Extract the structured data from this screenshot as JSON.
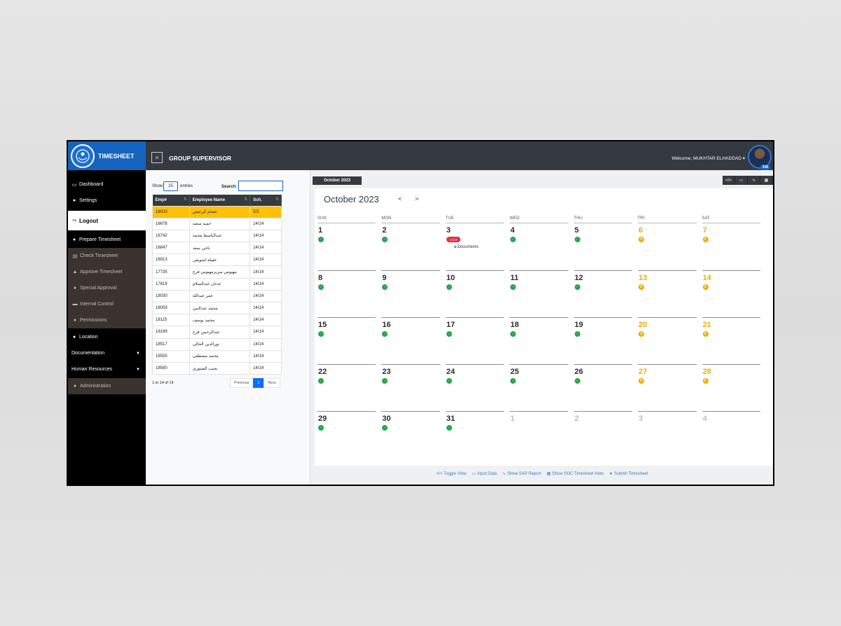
{
  "brand": {
    "title": "TIMESHEET"
  },
  "header": {
    "role_title": "GROUP SUPERVISOR",
    "welcome": "Welcome, MUKHTAR ELHADDAD",
    "avatar_badge": "348"
  },
  "sidebar": {
    "items": [
      {
        "label": "Dashboard",
        "icon": "monitor-icon"
      },
      {
        "label": "Settings",
        "icon": "user-cog-icon"
      },
      {
        "label": "Logout",
        "icon": "logout-icon"
      },
      {
        "label": "Prepare Timesheet",
        "icon": "user-cog-icon"
      },
      {
        "label": "Check Timesheet",
        "icon": "clipboard-icon"
      },
      {
        "label": "Approve Timesheet",
        "icon": "thumbs-up-icon"
      },
      {
        "label": "Special Approval",
        "icon": "user-icon"
      },
      {
        "label": "Internal Control",
        "icon": "id-card-icon"
      },
      {
        "label": "Permissions",
        "icon": "users-icon"
      },
      {
        "label": "Location",
        "icon": "users-icon"
      },
      {
        "label": "Documentation",
        "icon": "caret-down-icon"
      },
      {
        "label": "Human Resources",
        "icon": "caret-down-icon"
      },
      {
        "label": "Administration",
        "icon": "users-icon"
      }
    ]
  },
  "employees": {
    "show_label": "Show",
    "entries_value": "25",
    "entries_label": "entries",
    "search_label": "Search:",
    "columns": [
      "Emp#",
      "Employee Name",
      "Sch."
    ],
    "rows": [
      {
        "emp": "16023",
        "name": "عصام الرعيض",
        "sch": "5/2"
      },
      {
        "emp": "16678",
        "name": "حميد سعيد",
        "sch": "14/14"
      },
      {
        "emp": "16742",
        "name": "عبدالباسط محمد",
        "sch": "14/14"
      },
      {
        "emp": "16847",
        "name": "ناجي سعد",
        "sch": "14/14"
      },
      {
        "emp": "16913",
        "name": "عقيلة اشويقي",
        "sch": "14/14"
      },
      {
        "emp": "17735",
        "name": "مهيوس سريرمهيوس فرج",
        "sch": "14/14"
      },
      {
        "emp": "17819",
        "name": "عدنان عبدالسلام",
        "sch": "14/14"
      },
      {
        "emp": "18030",
        "name": "عمر عبدالله",
        "sch": "14/14"
      },
      {
        "emp": "18059",
        "name": "محمد عبدالنبي",
        "sch": "14/14"
      },
      {
        "emp": "18115",
        "name": "محمد يوسف",
        "sch": "14/14"
      },
      {
        "emp": "18199",
        "name": "عبدالرحمن فرج",
        "sch": "14/14"
      },
      {
        "emp": "18517",
        "name": "نورالدين الجالي",
        "sch": "14/14"
      },
      {
        "emp": "18555",
        "name": "محمد مصطفى",
        "sch": "14/14"
      },
      {
        "emp": "18580",
        "name": "نجيب الفيتوري",
        "sch": "14/14"
      }
    ],
    "info": "1 to 14 of 14",
    "pager": {
      "previous": "Previous",
      "current": "1",
      "next": "Next"
    }
  },
  "calendar": {
    "tab_label": "October 2023",
    "month_title": "October 2023",
    "prev": "<",
    "next": ">",
    "weekdays": [
      "SUN",
      "MON",
      "TUE",
      "WED",
      "THU",
      "FRI",
      "SAT"
    ],
    "document_link": "Documents",
    "absent_label": "A 2.0",
    "weekend_marker": "B",
    "workday_marker": "-",
    "weeks": [
      [
        "1",
        "2",
        "3",
        "4",
        "5",
        "6",
        "7"
      ],
      [
        "8",
        "9",
        "10",
        "11",
        "12",
        "13",
        "14"
      ],
      [
        "15",
        "16",
        "17",
        "18",
        "19",
        "20",
        "21"
      ],
      [
        "22",
        "23",
        "24",
        "25",
        "26",
        "27",
        "28"
      ],
      [
        "29",
        "30",
        "31",
        "1",
        "2",
        "3",
        "4"
      ]
    ]
  },
  "footer": {
    "links": [
      "Toggle View",
      "Input Data",
      "Show SAP Report",
      "Show SOC Timesheet View",
      "Submit Timesheet"
    ]
  },
  "colors": {
    "brand_blue": "#1565c0",
    "header_dark": "#343a40",
    "weekend": "#f0ad00",
    "ok_green": "#28a745",
    "absent_red": "#dc3545",
    "selected_row": "#ffc107"
  }
}
